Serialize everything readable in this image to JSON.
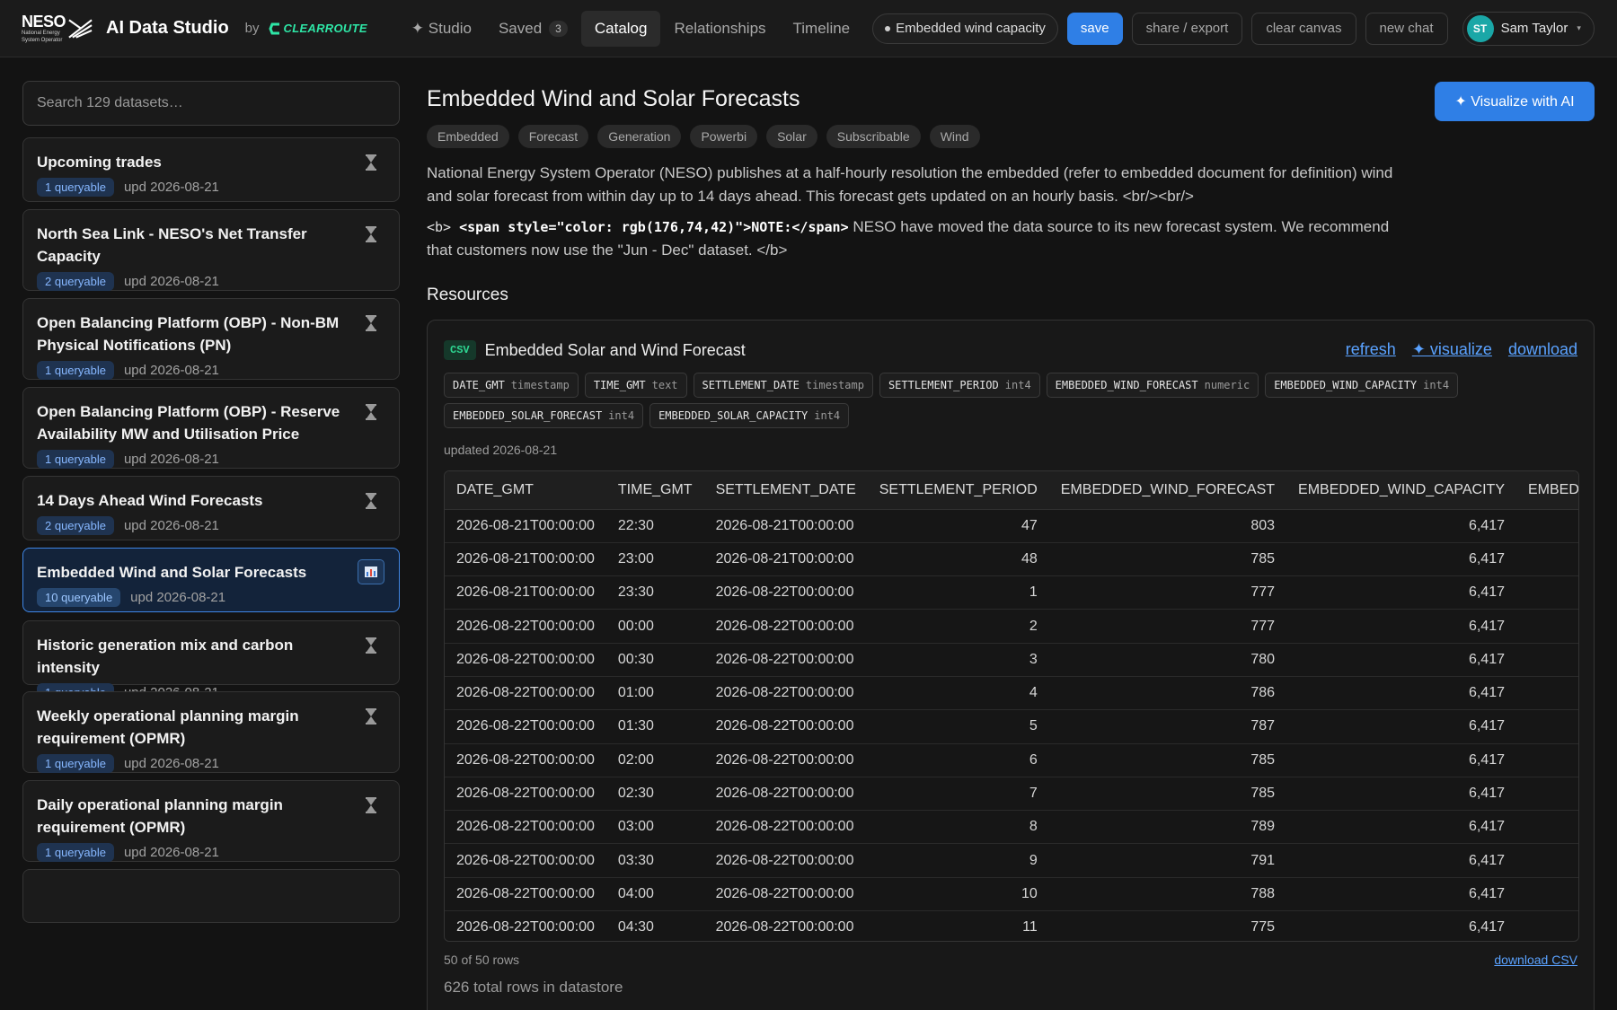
{
  "header": {
    "logo_text": "NESO",
    "logo_subtext": [
      "National Energy",
      "System Operator"
    ],
    "app_title": "AI Data Studio",
    "by_label": "by",
    "partner_logo": "CLEARROUTE",
    "nav": [
      {
        "label": "✦ Studio",
        "active": false
      },
      {
        "label": "Saved",
        "active": false,
        "count": "3"
      },
      {
        "label": "Catalog",
        "active": true
      },
      {
        "label": "Relationships",
        "active": false
      },
      {
        "label": "Timeline",
        "active": false
      }
    ],
    "context_pill": "Embedded wind capacity",
    "save_label": "save",
    "share_label": "share / export",
    "clear_label": "clear canvas",
    "new_chat_label": "new chat",
    "user": {
      "initials": "ST",
      "name": "Sam Taylor"
    }
  },
  "sidebar": {
    "search_placeholder": "Search 129 datasets…",
    "datasets": [
      {
        "title": "Upcoming trades",
        "queryable": "1 queryable",
        "updated": "upd 2026-08-21",
        "icon": "hourglass-icon",
        "selected": false
      },
      {
        "title": "North Sea Link - NESO's Net Transfer Capacity",
        "queryable": "2 queryable",
        "updated": "upd 2026-08-21",
        "icon": "hourglass-icon",
        "selected": false
      },
      {
        "title": "Open Balancing Platform (OBP) - Non-BM Physical Notifications (PN)",
        "queryable": "1 queryable",
        "updated": "upd 2026-08-21",
        "icon": "hourglass-icon",
        "selected": false
      },
      {
        "title": "Open Balancing Platform (OBP) - Reserve Availability MW and Utilisation Price",
        "queryable": "1 queryable",
        "updated": "upd 2026-08-21",
        "icon": "hourglass-icon",
        "selected": false
      },
      {
        "title": "14 Days Ahead Wind Forecasts",
        "queryable": "2 queryable",
        "updated": "upd 2026-08-21",
        "icon": "hourglass-icon",
        "selected": false
      },
      {
        "title": "Embedded Wind and Solar Forecasts",
        "queryable": "10 queryable",
        "updated": "upd 2026-08-21",
        "icon": "bar-chart-icon",
        "selected": true
      },
      {
        "title": "Historic generation mix and carbon intensity",
        "queryable": "1 queryable",
        "updated": "upd 2026-08-21",
        "icon": "hourglass-icon",
        "selected": false
      },
      {
        "title": "Weekly operational planning margin requirement (OPMR)",
        "queryable": "1 queryable",
        "updated": "upd 2026-08-21",
        "icon": "hourglass-icon",
        "selected": false
      },
      {
        "title": "Daily operational planning margin requirement (OPMR)",
        "queryable": "1 queryable",
        "updated": "upd 2026-08-21",
        "icon": "hourglass-icon",
        "selected": false
      }
    ]
  },
  "main": {
    "title": "Embedded Wind and Solar Forecasts",
    "visualize_label": "✦ Visualize with AI",
    "tags": [
      "Embedded",
      "Forecast",
      "Generation",
      "Powerbi",
      "Solar",
      "Subscribable",
      "Wind"
    ],
    "description": "National Energy System Operator (NESO) publishes at a half-hourly resolution the embedded (refer to embedded document for definition) wind and solar forecast from within day up to 14 days ahead. This forecast gets updated on an hourly basis. <br/><br/>",
    "note_prefix": "<b> ",
    "note_bold": "<span style=\"color: rgb(176,74,42)\">NOTE:</span>",
    "note_text": " NESO have moved the data source to its new forecast system. We recommend that customers now use the \"Jun - Dec\" dataset. </b>",
    "resources_label": "Resources",
    "resource": {
      "format": "CSV",
      "name": "Embedded Solar and Wind Forecast",
      "links": {
        "refresh": "refresh",
        "visualize": "✦ visualize",
        "download": "download"
      },
      "columns": [
        {
          "name": "DATE_GMT",
          "type": "timestamp"
        },
        {
          "name": "TIME_GMT",
          "type": "text"
        },
        {
          "name": "SETTLEMENT_DATE",
          "type": "timestamp"
        },
        {
          "name": "SETTLEMENT_PERIOD",
          "type": "int4"
        },
        {
          "name": "EMBEDDED_WIND_FORECAST",
          "type": "numeric"
        },
        {
          "name": "EMBEDDED_WIND_CAPACITY",
          "type": "int4"
        },
        {
          "name": "EMBEDDED_SOLAR_FORECAST",
          "type": "int4"
        },
        {
          "name": "EMBEDDED_SOLAR_CAPACITY",
          "type": "int4"
        }
      ],
      "updated": "updated 2026-08-21",
      "table_headers": [
        "DATE_GMT",
        "TIME_GMT",
        "SETTLEMENT_DATE",
        "SETTLEMENT_PERIOD",
        "EMBEDDED_WIND_FORECAST",
        "EMBEDDED_WIND_CAPACITY",
        "EMBEDDED_SOLAR_FC"
      ],
      "rows": [
        [
          "2026-08-21T00:00:00",
          "22:30",
          "2026-08-21T00:00:00",
          "47",
          "803",
          "6,417",
          ""
        ],
        [
          "2026-08-21T00:00:00",
          "23:00",
          "2026-08-21T00:00:00",
          "48",
          "785",
          "6,417",
          ""
        ],
        [
          "2026-08-21T00:00:00",
          "23:30",
          "2026-08-22T00:00:00",
          "1",
          "777",
          "6,417",
          ""
        ],
        [
          "2026-08-22T00:00:00",
          "00:00",
          "2026-08-22T00:00:00",
          "2",
          "777",
          "6,417",
          ""
        ],
        [
          "2026-08-22T00:00:00",
          "00:30",
          "2026-08-22T00:00:00",
          "3",
          "780",
          "6,417",
          ""
        ],
        [
          "2026-08-22T00:00:00",
          "01:00",
          "2026-08-22T00:00:00",
          "4",
          "786",
          "6,417",
          ""
        ],
        [
          "2026-08-22T00:00:00",
          "01:30",
          "2026-08-22T00:00:00",
          "5",
          "787",
          "6,417",
          ""
        ],
        [
          "2026-08-22T00:00:00",
          "02:00",
          "2026-08-22T00:00:00",
          "6",
          "785",
          "6,417",
          ""
        ],
        [
          "2026-08-22T00:00:00",
          "02:30",
          "2026-08-22T00:00:00",
          "7",
          "785",
          "6,417",
          ""
        ],
        [
          "2026-08-22T00:00:00",
          "03:00",
          "2026-08-22T00:00:00",
          "8",
          "789",
          "6,417",
          ""
        ],
        [
          "2026-08-22T00:00:00",
          "03:30",
          "2026-08-22T00:00:00",
          "9",
          "791",
          "6,417",
          ""
        ],
        [
          "2026-08-22T00:00:00",
          "04:00",
          "2026-08-22T00:00:00",
          "10",
          "788",
          "6,417",
          ""
        ],
        [
          "2026-08-22T00:00:00",
          "04:30",
          "2026-08-22T00:00:00",
          "11",
          "775",
          "6,417",
          ""
        ]
      ],
      "rows_shown": "50 of 50 rows",
      "download_csv": "download CSV",
      "total_rows": "626 total rows in datastore"
    }
  },
  "colors": {
    "accent": "#2f7fe6",
    "link": "#5aa2ff",
    "csv_badge": "#2ed591",
    "partner": "#2ee6a6",
    "avatar": "#1aa7a7"
  }
}
